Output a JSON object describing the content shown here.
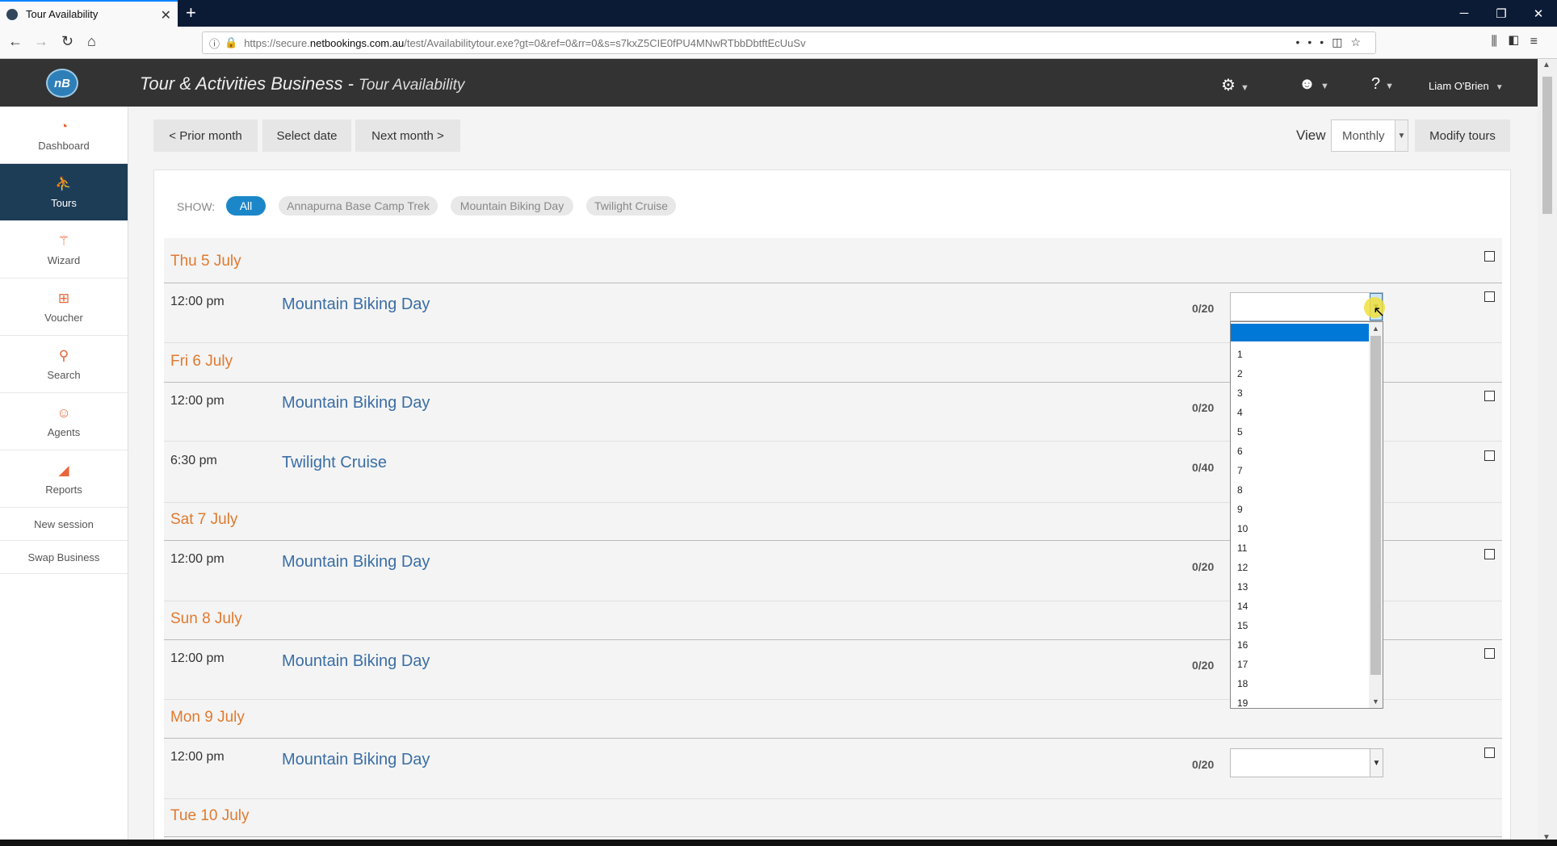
{
  "browser": {
    "tab_title": "Tour Availability",
    "url_prefix": "https://secure.",
    "url_domain": "netbookings.com.au",
    "url_path": "/test/Availabilitytour.exe?gt=0&ref=0&rr=0&s=s7kxZ5CIE0fPU4MNwRTbbDbtftEcUuSv"
  },
  "header": {
    "logo_text": "nB",
    "title": "Tour & Activities Business",
    "separator": " - ",
    "subtitle": "Tour Availability",
    "user_name": "Liam O'Brien"
  },
  "sidebar": {
    "items": [
      {
        "label": "Dashboard",
        "icon": "gauge-icon"
      },
      {
        "label": "Tours",
        "icon": "hiker-icon",
        "active": true
      },
      {
        "label": "Wizard",
        "icon": "wand-icon"
      },
      {
        "label": "Voucher",
        "icon": "gift-icon"
      },
      {
        "label": "Search",
        "icon": "search-icon"
      },
      {
        "label": "Agents",
        "icon": "agent-icon"
      },
      {
        "label": "Reports",
        "icon": "chart-icon"
      }
    ],
    "links": [
      "New session",
      "Swap Business"
    ]
  },
  "toolbar": {
    "prior_month": "< Prior month",
    "select_date": "Select date",
    "next_month": "Next month >",
    "view_label": "View",
    "view_value": "Monthly",
    "modify_tours": "Modify tours"
  },
  "filter": {
    "show_label": "SHOW:",
    "chips": [
      "All",
      "Annapurna Base Camp Trek",
      "Mountain Biking Day",
      "Twilight Cruise"
    ]
  },
  "days": [
    {
      "label": "Thu 5 July",
      "rows": [
        {
          "time": "12:00 pm",
          "tour": "Mountain Biking Day",
          "capacity": "0/20"
        }
      ]
    },
    {
      "label": "Fri 6 July",
      "rows": [
        {
          "time": "12:00 pm",
          "tour": "Mountain Biking Day",
          "capacity": "0/20"
        },
        {
          "time": "6:30 pm",
          "tour": "Twilight Cruise",
          "capacity": "0/40"
        }
      ]
    },
    {
      "label": "Sat 7 July",
      "rows": [
        {
          "time": "12:00 pm",
          "tour": "Mountain Biking Day",
          "capacity": "0/20"
        }
      ]
    },
    {
      "label": "Sun 8 July",
      "rows": [
        {
          "time": "12:00 pm",
          "tour": "Mountain Biking Day",
          "capacity": "0/20"
        }
      ]
    },
    {
      "label": "Mon 9 July",
      "rows": [
        {
          "time": "12:00 pm",
          "tour": "Mountain Biking Day",
          "capacity": "0/20"
        }
      ]
    },
    {
      "label": "Tue 10 July",
      "rows": []
    }
  ],
  "dropdown": {
    "selected": "",
    "options": [
      "1",
      "2",
      "3",
      "4",
      "5",
      "6",
      "7",
      "8",
      "9",
      "10",
      "11",
      "12",
      "13",
      "14",
      "15",
      "16",
      "17",
      "18",
      "19"
    ]
  }
}
